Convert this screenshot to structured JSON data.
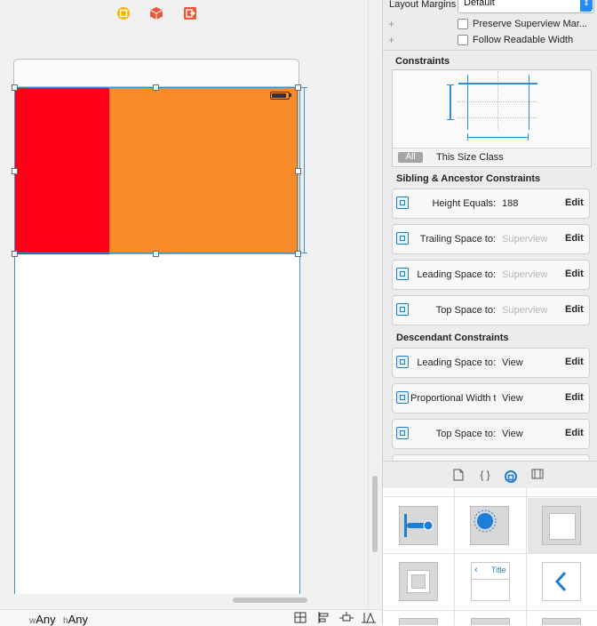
{
  "canvas": {
    "size_class": {
      "w_prefix": "w",
      "w_value": "Any",
      "h_prefix": "h",
      "h_value": "Any"
    },
    "views": {
      "red_color": "#ff0018",
      "orange_color": "#fa8b2a",
      "selection_color": "#3d8fc4"
    },
    "dock_icons": [
      "view-controller-icon",
      "first-responder-icon",
      "exit-icon"
    ],
    "bottom_tools": [
      "stack-icon",
      "align-icon",
      "pin-icon",
      "resolve-issues-icon"
    ]
  },
  "inspector": {
    "layout_margins_label": "Layout Margins",
    "layout_margins_value": "Default",
    "preserve_superview": "Preserve Superview Mar...",
    "follow_readable": "Follow Readable Width",
    "constraints_heading": "Constraints",
    "filter_all": "All",
    "filter_size_class": "This Size Class",
    "sibling_heading": "Sibling & Ancestor Constraints",
    "descendant_heading": "Descendant Constraints",
    "edit_label": "Edit",
    "sibling_rows": [
      {
        "label": "Height Equals:",
        "value": "188",
        "muted": false
      },
      {
        "label": "Trailing Space to:",
        "value": "Superview",
        "muted": true
      },
      {
        "label": "Leading Space to:",
        "value": "Superview",
        "muted": true
      },
      {
        "label": "Top Space to:",
        "value": "Superview",
        "muted": true
      }
    ],
    "descendant_rows": [
      {
        "label": "Leading Space to:",
        "value": "View",
        "muted": false
      },
      {
        "label": "Proportional Width t",
        "value": "View",
        "muted": false
      },
      {
        "label": "Top Space to:",
        "value": "View",
        "muted": false
      }
    ],
    "accent_color": "#1c7ed6"
  },
  "library": {
    "tabs": [
      "file-template-icon",
      "code-snippet-icon",
      "object-library-icon",
      "media-library-icon"
    ],
    "selected_tab": "object-library-icon",
    "nav_item_title": "Title"
  }
}
